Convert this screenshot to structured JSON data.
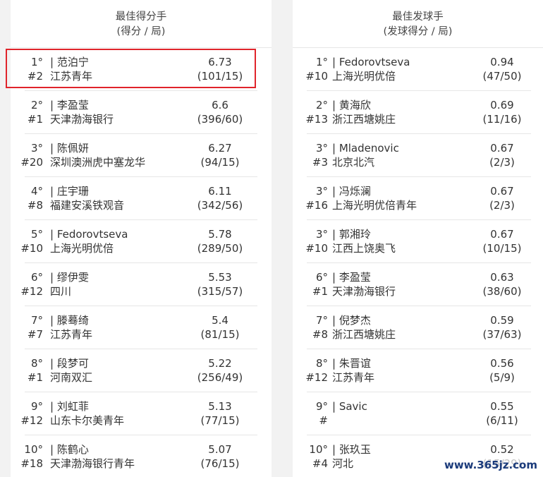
{
  "left": {
    "title": "最佳得分手",
    "subtitle": "(得分 / 局)",
    "rows": [
      {
        "rank": "1°",
        "seed": "#2",
        "name": "| 范泊宁",
        "team": "江苏青年",
        "value": "6.73",
        "fraction": "(101/15)"
      },
      {
        "rank": "2°",
        "seed": "#1",
        "name": "| 李盈莹",
        "team": "天津渤海银行",
        "value": "6.6",
        "fraction": "(396/60)"
      },
      {
        "rank": "3°",
        "seed": "#20",
        "name": "| 陈佩妍",
        "team": "深圳澳洲虎中塞龙华",
        "value": "6.27",
        "fraction": "(94/15)"
      },
      {
        "rank": "4°",
        "seed": "#8",
        "name": "| 庄宇珊",
        "team": "福建安溪铁观音",
        "value": "6.11",
        "fraction": "(342/56)"
      },
      {
        "rank": "5°",
        "seed": "#10",
        "name": "| Fedorovtseva",
        "team": "上海光明优倍",
        "value": "5.78",
        "fraction": "(289/50)"
      },
      {
        "rank": "6°",
        "seed": "#12",
        "name": "| 缪伊雯",
        "team": "四川",
        "value": "5.53",
        "fraction": "(315/57)"
      },
      {
        "rank": "7°",
        "seed": "#7",
        "name": "| 滕蓦绮",
        "team": "江苏青年",
        "value": "5.4",
        "fraction": "(81/15)"
      },
      {
        "rank": "8°",
        "seed": "#1",
        "name": "| 段梦可",
        "team": "河南双汇",
        "value": "5.22",
        "fraction": "(256/49)"
      },
      {
        "rank": "9°",
        "seed": "#12",
        "name": "| 刘虹菲",
        "team": "山东卡尔美青年",
        "value": "5.13",
        "fraction": "(77/15)"
      },
      {
        "rank": "10°",
        "seed": "#18",
        "name": "| 陈鹤心",
        "team": "天津渤海银行青年",
        "value": "5.07",
        "fraction": "(76/15)"
      }
    ]
  },
  "right": {
    "title": "最佳发球手",
    "subtitle": "(发球得分 / 局)",
    "rows": [
      {
        "rank": "1°",
        "seed": "#10",
        "name": "| Fedorovtseva",
        "team": "上海光明优倍",
        "value": "0.94",
        "fraction": "(47/50)"
      },
      {
        "rank": "2°",
        "seed": "#13",
        "name": "| 黄海欣",
        "team": "浙江西塘姚庄",
        "value": "0.69",
        "fraction": "(11/16)"
      },
      {
        "rank": "3°",
        "seed": "#3",
        "name": "| Mladenovic",
        "team": "北京北汽",
        "value": "0.67",
        "fraction": "(2/3)"
      },
      {
        "rank": "3°",
        "seed": "#16",
        "name": "| 冯烁澜",
        "team": "上海光明优倍青年",
        "value": "0.67",
        "fraction": "(2/3)"
      },
      {
        "rank": "3°",
        "seed": "#10",
        "name": "| 郭湘玲",
        "team": "江西上饶奥飞",
        "value": "0.67",
        "fraction": "(10/15)"
      },
      {
        "rank": "6°",
        "seed": "#1",
        "name": "| 李盈莹",
        "team": "天津渤海银行",
        "value": "0.63",
        "fraction": "(38/60)"
      },
      {
        "rank": "7°",
        "seed": "#8",
        "name": "| 倪梦杰",
        "team": "浙江西塘姚庄",
        "value": "0.59",
        "fraction": "(37/63)"
      },
      {
        "rank": "8°",
        "seed": "#12",
        "name": "| 朱晋谊",
        "team": "江苏青年",
        "value": "0.56",
        "fraction": "(5/9)"
      },
      {
        "rank": "9°",
        "seed": "#",
        "name": "| Savic",
        "team": "",
        "value": "0.55",
        "fraction": "(6/11)"
      },
      {
        "rank": "10°",
        "seed": "#4",
        "name": "| 张玖玉",
        "team": "河北",
        "value": "0.52",
        "fraction": "(15/29)"
      }
    ]
  },
  "watermark": "www.365jz.com",
  "colors": {
    "highlight": "#e0242b",
    "background": "#f2f2f2",
    "panel": "#ffffff"
  }
}
